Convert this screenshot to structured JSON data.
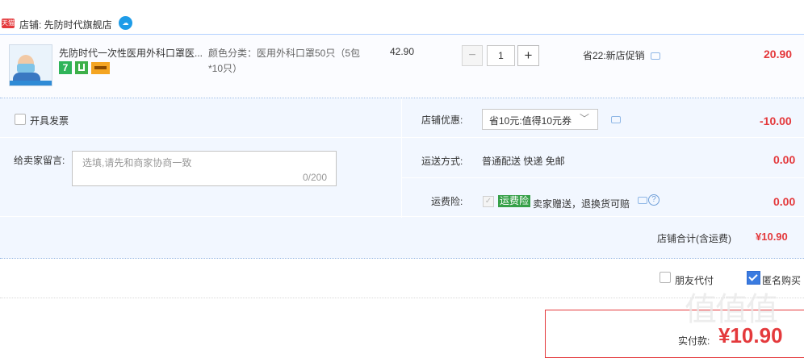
{
  "shop": {
    "platform_badge": "天猫",
    "label": "店铺: 先防时代旗舰店"
  },
  "item": {
    "title": "先防时代一次性医用外科口罩医...",
    "badge_number": "7",
    "sku_label": "颜色分类：医用外科口罩50只（5包*10只）",
    "unit_price": "42.90",
    "quantity": "1",
    "qty_minus": "−",
    "qty_plus": "+",
    "promotion": "省22:新店促销",
    "subtotal": "20.90"
  },
  "invoice": {
    "label": "开具发票"
  },
  "message": {
    "label": "给卖家留言:",
    "placeholder": "选填,请先和商家协商一致",
    "counter": "0/200"
  },
  "coupon": {
    "label": "店铺优惠:",
    "selected": "省10元:值得10元券",
    "amount": "-10.00"
  },
  "shipping": {
    "label": "运送方式:",
    "value": "普通配送 快递 免邮",
    "amount": "0.00"
  },
  "insurance": {
    "label": "运费险:",
    "tag": "运费险",
    "description": "卖家赠送，退换货可赔",
    "amount": "0.00"
  },
  "shop_total": {
    "label": "店铺合计(含运费)",
    "amount": "¥10.90"
  },
  "options": {
    "friend_pay": "朋友代付",
    "anonymous": "匿名购买"
  },
  "payment": {
    "label": "实付款:",
    "amount": "¥10.90"
  },
  "watermark": {
    "text": "值值值"
  },
  "colors": {
    "price_red": "#e4393c",
    "option_bg": "#f2f7ff",
    "divider_blue": "#9cbbe6",
    "checkbox_blue": "#3a7be0",
    "insurance_green": "#36a048"
  },
  "icons": [
    "tmall-badge-icon",
    "wangwang-chat-icon",
    "message-icon",
    "help-icon",
    "chevron-down-icon",
    "checkmark-icon"
  ]
}
